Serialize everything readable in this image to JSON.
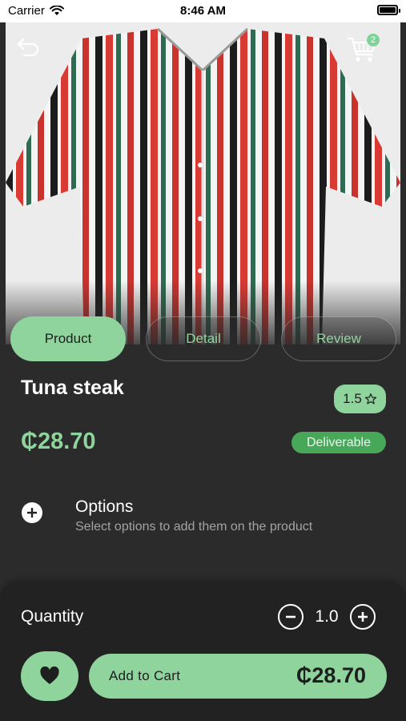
{
  "status": {
    "carrier": "Carrier",
    "time": "8:46 AM"
  },
  "header": {
    "cart_badge": "2"
  },
  "tabs": [
    {
      "label": "Product",
      "active": true
    },
    {
      "label": "Detail",
      "active": false
    },
    {
      "label": "Review",
      "active": false
    }
  ],
  "product": {
    "name": "Tuna steak",
    "rating": "1.5",
    "price": "₵28.70",
    "availability": "Deliverable"
  },
  "options": {
    "title": "Options",
    "subtitle": "Select options to add them on the product"
  },
  "footer": {
    "quantity_label": "Quantity",
    "quantity_value": "1.0",
    "add_to_cart_label": "Add to Cart",
    "total_price": "₵28.70"
  },
  "colors": {
    "accent": "#8fd49c",
    "background": "#2b2b2b",
    "panel": "#222222",
    "deliverable": "#48a85a"
  },
  "icons": [
    "back-arrow-icon",
    "cart-icon",
    "star-icon",
    "plus-circle-icon",
    "minus-circle-icon",
    "heart-icon",
    "wifi-icon",
    "battery-icon"
  ]
}
